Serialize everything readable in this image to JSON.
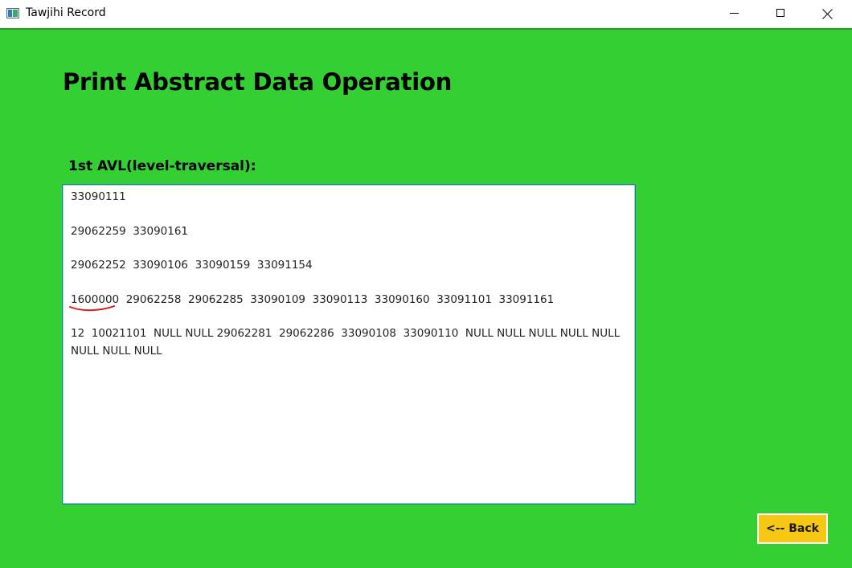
{
  "window": {
    "title": "Tawjihi Record",
    "icon": "app-window-icon"
  },
  "page": {
    "title": "Print Abstract Data Operation"
  },
  "section": {
    "label": "1st AVL(level-traversal):"
  },
  "output": {
    "lines": [
      "33090111",
      "29062259  33090161",
      "29062252  33090106  33090159  33091154",
      "29062258  29062285  33090109  33090113  33090160  33091101  33091161",
      "12  10021101  NULL NULL 29062281  29062286  33090108  33090110  NULL NULL NULL NULL NULL",
      "NULL NULL NULL"
    ],
    "highlighted_value": "1600000"
  },
  "buttons": {
    "back_label": "<-- Back"
  },
  "colors": {
    "background": "#33cf33",
    "back_button": "#f6c814",
    "annotation": "#d81e1e"
  }
}
